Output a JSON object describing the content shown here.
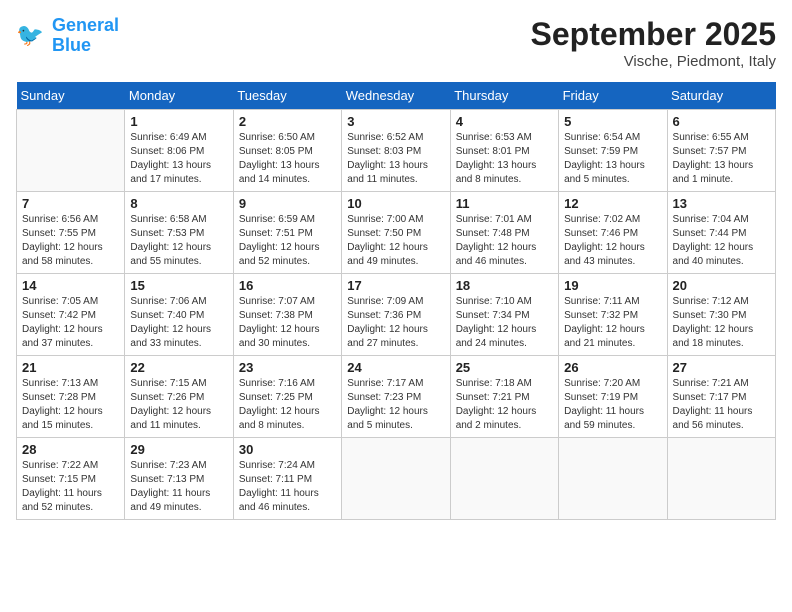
{
  "header": {
    "logo_general": "General",
    "logo_blue": "Blue",
    "month": "September 2025",
    "location": "Vische, Piedmont, Italy"
  },
  "days_of_week": [
    "Sunday",
    "Monday",
    "Tuesday",
    "Wednesday",
    "Thursday",
    "Friday",
    "Saturday"
  ],
  "weeks": [
    [
      {
        "day": "",
        "empty": true
      },
      {
        "day": "1",
        "sunrise": "Sunrise: 6:49 AM",
        "sunset": "Sunset: 8:06 PM",
        "daylight": "Daylight: 13 hours and 17 minutes."
      },
      {
        "day": "2",
        "sunrise": "Sunrise: 6:50 AM",
        "sunset": "Sunset: 8:05 PM",
        "daylight": "Daylight: 13 hours and 14 minutes."
      },
      {
        "day": "3",
        "sunrise": "Sunrise: 6:52 AM",
        "sunset": "Sunset: 8:03 PM",
        "daylight": "Daylight: 13 hours and 11 minutes."
      },
      {
        "day": "4",
        "sunrise": "Sunrise: 6:53 AM",
        "sunset": "Sunset: 8:01 PM",
        "daylight": "Daylight: 13 hours and 8 minutes."
      },
      {
        "day": "5",
        "sunrise": "Sunrise: 6:54 AM",
        "sunset": "Sunset: 7:59 PM",
        "daylight": "Daylight: 13 hours and 5 minutes."
      },
      {
        "day": "6",
        "sunrise": "Sunrise: 6:55 AM",
        "sunset": "Sunset: 7:57 PM",
        "daylight": "Daylight: 13 hours and 1 minute."
      }
    ],
    [
      {
        "day": "7",
        "sunrise": "Sunrise: 6:56 AM",
        "sunset": "Sunset: 7:55 PM",
        "daylight": "Daylight: 12 hours and 58 minutes."
      },
      {
        "day": "8",
        "sunrise": "Sunrise: 6:58 AM",
        "sunset": "Sunset: 7:53 PM",
        "daylight": "Daylight: 12 hours and 55 minutes."
      },
      {
        "day": "9",
        "sunrise": "Sunrise: 6:59 AM",
        "sunset": "Sunset: 7:51 PM",
        "daylight": "Daylight: 12 hours and 52 minutes."
      },
      {
        "day": "10",
        "sunrise": "Sunrise: 7:00 AM",
        "sunset": "Sunset: 7:50 PM",
        "daylight": "Daylight: 12 hours and 49 minutes."
      },
      {
        "day": "11",
        "sunrise": "Sunrise: 7:01 AM",
        "sunset": "Sunset: 7:48 PM",
        "daylight": "Daylight: 12 hours and 46 minutes."
      },
      {
        "day": "12",
        "sunrise": "Sunrise: 7:02 AM",
        "sunset": "Sunset: 7:46 PM",
        "daylight": "Daylight: 12 hours and 43 minutes."
      },
      {
        "day": "13",
        "sunrise": "Sunrise: 7:04 AM",
        "sunset": "Sunset: 7:44 PM",
        "daylight": "Daylight: 12 hours and 40 minutes."
      }
    ],
    [
      {
        "day": "14",
        "sunrise": "Sunrise: 7:05 AM",
        "sunset": "Sunset: 7:42 PM",
        "daylight": "Daylight: 12 hours and 37 minutes."
      },
      {
        "day": "15",
        "sunrise": "Sunrise: 7:06 AM",
        "sunset": "Sunset: 7:40 PM",
        "daylight": "Daylight: 12 hours and 33 minutes."
      },
      {
        "day": "16",
        "sunrise": "Sunrise: 7:07 AM",
        "sunset": "Sunset: 7:38 PM",
        "daylight": "Daylight: 12 hours and 30 minutes."
      },
      {
        "day": "17",
        "sunrise": "Sunrise: 7:09 AM",
        "sunset": "Sunset: 7:36 PM",
        "daylight": "Daylight: 12 hours and 27 minutes."
      },
      {
        "day": "18",
        "sunrise": "Sunrise: 7:10 AM",
        "sunset": "Sunset: 7:34 PM",
        "daylight": "Daylight: 12 hours and 24 minutes."
      },
      {
        "day": "19",
        "sunrise": "Sunrise: 7:11 AM",
        "sunset": "Sunset: 7:32 PM",
        "daylight": "Daylight: 12 hours and 21 minutes."
      },
      {
        "day": "20",
        "sunrise": "Sunrise: 7:12 AM",
        "sunset": "Sunset: 7:30 PM",
        "daylight": "Daylight: 12 hours and 18 minutes."
      }
    ],
    [
      {
        "day": "21",
        "sunrise": "Sunrise: 7:13 AM",
        "sunset": "Sunset: 7:28 PM",
        "daylight": "Daylight: 12 hours and 15 minutes."
      },
      {
        "day": "22",
        "sunrise": "Sunrise: 7:15 AM",
        "sunset": "Sunset: 7:26 PM",
        "daylight": "Daylight: 12 hours and 11 minutes."
      },
      {
        "day": "23",
        "sunrise": "Sunrise: 7:16 AM",
        "sunset": "Sunset: 7:25 PM",
        "daylight": "Daylight: 12 hours and 8 minutes."
      },
      {
        "day": "24",
        "sunrise": "Sunrise: 7:17 AM",
        "sunset": "Sunset: 7:23 PM",
        "daylight": "Daylight: 12 hours and 5 minutes."
      },
      {
        "day": "25",
        "sunrise": "Sunrise: 7:18 AM",
        "sunset": "Sunset: 7:21 PM",
        "daylight": "Daylight: 12 hours and 2 minutes."
      },
      {
        "day": "26",
        "sunrise": "Sunrise: 7:20 AM",
        "sunset": "Sunset: 7:19 PM",
        "daylight": "Daylight: 11 hours and 59 minutes."
      },
      {
        "day": "27",
        "sunrise": "Sunrise: 7:21 AM",
        "sunset": "Sunset: 7:17 PM",
        "daylight": "Daylight: 11 hours and 56 minutes."
      }
    ],
    [
      {
        "day": "28",
        "sunrise": "Sunrise: 7:22 AM",
        "sunset": "Sunset: 7:15 PM",
        "daylight": "Daylight: 11 hours and 52 minutes."
      },
      {
        "day": "29",
        "sunrise": "Sunrise: 7:23 AM",
        "sunset": "Sunset: 7:13 PM",
        "daylight": "Daylight: 11 hours and 49 minutes."
      },
      {
        "day": "30",
        "sunrise": "Sunrise: 7:24 AM",
        "sunset": "Sunset: 7:11 PM",
        "daylight": "Daylight: 11 hours and 46 minutes."
      },
      {
        "day": "",
        "empty": true
      },
      {
        "day": "",
        "empty": true
      },
      {
        "day": "",
        "empty": true
      },
      {
        "day": "",
        "empty": true
      }
    ]
  ]
}
